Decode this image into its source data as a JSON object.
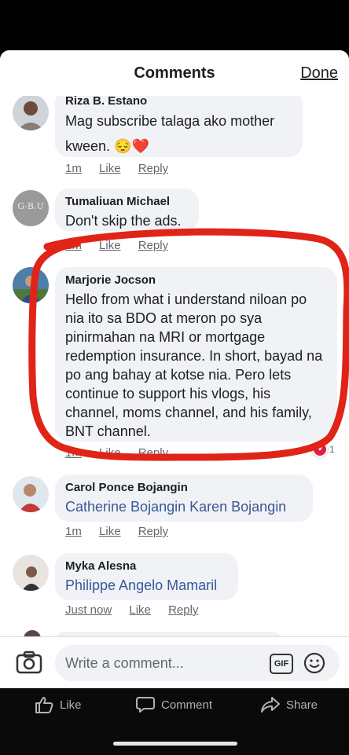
{
  "header": {
    "title": "Comments",
    "done_label": "Done"
  },
  "comments": [
    {
      "name": "Riza B. Estano",
      "text": "Mag subscribe talaga ako mother kween. 😔❤️",
      "time": "1m",
      "like": "Like",
      "reply": "Reply"
    },
    {
      "name": "Tumaliuan Michael",
      "avatar_text": "G-B.U",
      "text": "Don't skip the ads.",
      "time": "1m",
      "like": "Like",
      "reply": "Reply"
    },
    {
      "name": "Marjorie Jocson",
      "text": "Hello from what i understand niloan po nia ito sa BDO at meron po sya pinirmahan na MRI or mortgage redemption insurance. In short, bayad na po ang bahay at kotse nia. Pero lets continue to support his vlogs, his channel, moms channel, and his family, BNT channel.",
      "time": "1m",
      "like": "Like",
      "reply": "Reply",
      "reaction_count": "1"
    },
    {
      "name": "Carol Ponce Bojangin",
      "text": "Catherine Bojangin Karen Bojangin",
      "time": "1m",
      "like": "Like",
      "reply": "Reply"
    },
    {
      "name": "Myka Alesna",
      "text": "Philippe Angelo Mamaril",
      "time": "Just now",
      "like": "Like",
      "reply": "Reply"
    }
  ],
  "composer": {
    "placeholder": "Write a comment...",
    "gif_label": "GIF"
  },
  "bottom_bar": {
    "like": "Like",
    "comment": "Comment",
    "share": "Share"
  },
  "colors": {
    "annotation_circle": "#e02418",
    "mention_link": "#385898",
    "reaction_badge": "#e41e3f"
  }
}
